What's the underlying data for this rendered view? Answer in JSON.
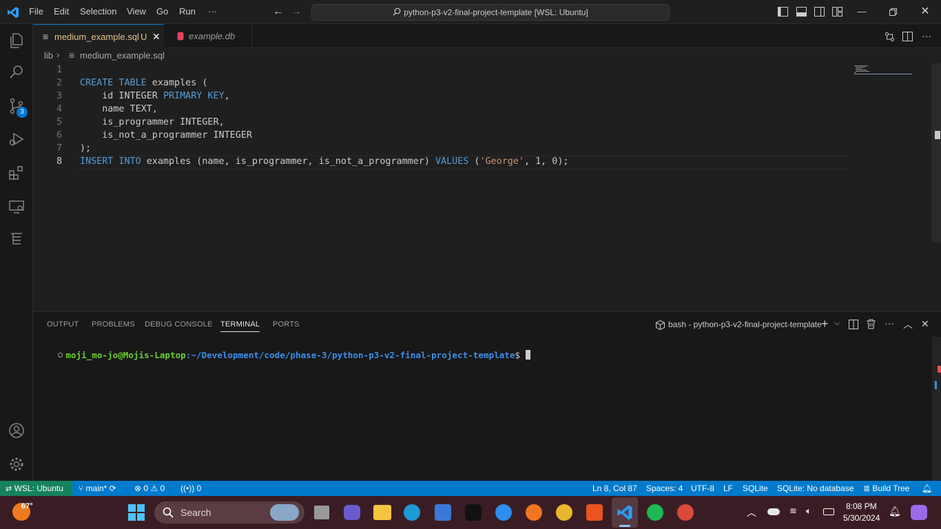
{
  "titlebar": {
    "menu": [
      "File",
      "Edit",
      "Selection",
      "View",
      "Go",
      "Run",
      "···"
    ],
    "search_text": "python-p3-v2-final-project-template [WSL: Ubuntu]"
  },
  "activity": {
    "source_control_badge": "3"
  },
  "tabs": [
    {
      "label": "medium_example.sql",
      "status": "U"
    },
    {
      "label": "example.db"
    }
  ],
  "breadcrumb": {
    "folder": "lib",
    "file": "medium_example.sql"
  },
  "editor": {
    "line_numbers": [
      "1",
      "2",
      "3",
      "4",
      "5",
      "6",
      "7",
      "8"
    ],
    "lines": [
      [],
      [
        {
          "t": "CREATE TABLE",
          "c": "kw"
        },
        {
          "t": " examples ("
        }
      ],
      [
        {
          "t": "    id INTEGER "
        },
        {
          "t": "PRIMARY KEY",
          "c": "kw"
        },
        {
          "t": ","
        }
      ],
      [
        {
          "t": "    name TEXT,"
        }
      ],
      [
        {
          "t": "    is_programmer INTEGER,"
        }
      ],
      [
        {
          "t": "    is_not_a_programmer INTEGER"
        }
      ],
      [
        {
          "t": ");"
        }
      ],
      [
        {
          "t": "INSERT INTO",
          "c": "kw"
        },
        {
          "t": " examples (name, is_programmer, is_not_a_programmer) "
        },
        {
          "t": "VALUES",
          "c": "kw"
        },
        {
          "t": " ("
        },
        {
          "t": "'George'",
          "c": "str"
        },
        {
          "t": ", "
        },
        {
          "t": "1",
          "c": "num"
        },
        {
          "t": ", "
        },
        {
          "t": "0",
          "c": "num"
        },
        {
          "t": ");"
        }
      ]
    ]
  },
  "panel": {
    "tabs": [
      "OUTPUT",
      "PROBLEMS",
      "DEBUG CONSOLE",
      "TERMINAL",
      "PORTS"
    ],
    "terminal_name": "bash - python-p3-v2-final-project-template",
    "prompt_user": "moji_mo-jo@Mojis-Laptop",
    "prompt_path": ":~/Development/code/phase-3/python-p3-v2-final-project-template",
    "prompt_symbol": "$"
  },
  "statusbar": {
    "remote": "WSL: Ubuntu",
    "branch": "main*",
    "errors": "0",
    "warnings": "0",
    "ports": "0",
    "position": "Ln 8, Col 87",
    "spaces": "Spaces: 4",
    "encoding": "UTF-8",
    "eol": "LF",
    "language": "SQLite",
    "db": "SQLite: No database",
    "build": "Build Tree"
  },
  "taskbar": {
    "weather": "67°",
    "search": "Search",
    "time": "8:08 PM",
    "date": "5/30/2024"
  },
  "colors": {
    "accent": "#007acc",
    "remote": "#16825d",
    "keyword": "#569cd6",
    "string": "#ce9178",
    "number": "#b5cea8",
    "prompt_user": "#6bcd2f",
    "prompt_path": "#3b8eea"
  }
}
